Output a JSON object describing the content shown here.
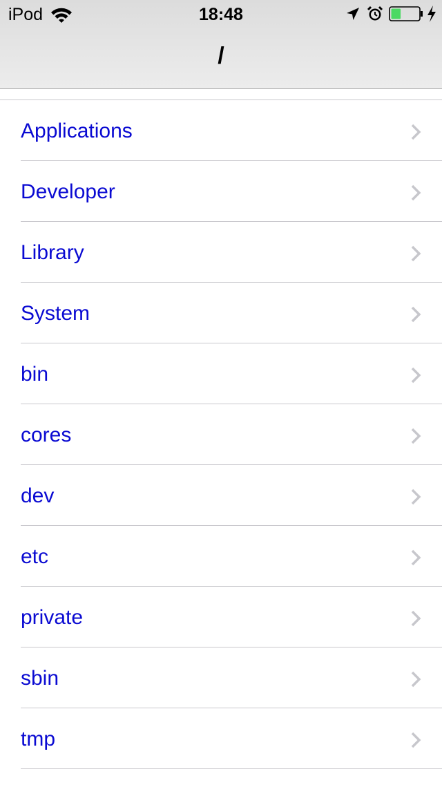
{
  "status_bar": {
    "carrier": "iPod",
    "time": "18:48",
    "icons": [
      "wifi-icon",
      "location-arrow-icon",
      "alarm-clock-icon",
      "battery-icon",
      "charging-bolt-icon"
    ],
    "battery_level": 0.35,
    "battery_color": "#4cd964"
  },
  "nav": {
    "title": "/"
  },
  "colors": {
    "link": "#0a0ad2",
    "separator": "#c8c7cc",
    "chevron": "#c7c7cc"
  },
  "list": {
    "items": [
      {
        "label": "Applications"
      },
      {
        "label": "Developer"
      },
      {
        "label": "Library"
      },
      {
        "label": "System"
      },
      {
        "label": "bin"
      },
      {
        "label": "cores"
      },
      {
        "label": "dev"
      },
      {
        "label": "etc"
      },
      {
        "label": "private"
      },
      {
        "label": "sbin"
      },
      {
        "label": "tmp"
      }
    ]
  }
}
